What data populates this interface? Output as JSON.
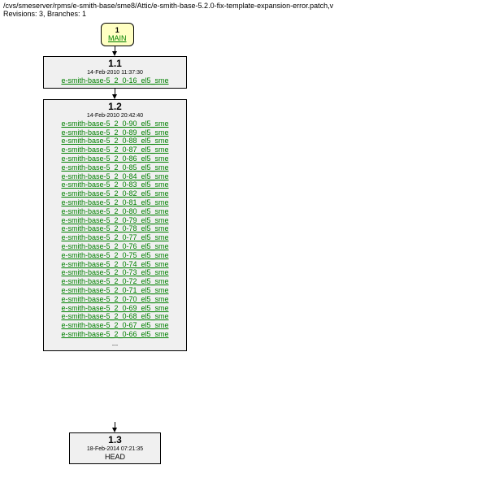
{
  "header": {
    "path": "/cvs/smeserver/rpms/e-smith-base/sme8/Attic/e-smith-base-5.2.0-fix-template-expansion-error.patch,v",
    "stats": "Revisions: 3, Branches: 1"
  },
  "branch": {
    "num": "1",
    "name": "MAIN"
  },
  "rev1": {
    "num": "1.1",
    "date": "14-Feb-2010 11:37:30",
    "tag": "e-smith-base-5_2_0-16_el5_sme"
  },
  "rev2": {
    "num": "1.2",
    "date": "14-Feb-2010 20:42:40",
    "tags": [
      "e-smith-base-5_2_0-90_el5_sme",
      "e-smith-base-5_2_0-89_el5_sme",
      "e-smith-base-5_2_0-88_el5_sme",
      "e-smith-base-5_2_0-87_el5_sme",
      "e-smith-base-5_2_0-86_el5_sme",
      "e-smith-base-5_2_0-85_el5_sme",
      "e-smith-base-5_2_0-84_el5_sme",
      "e-smith-base-5_2_0-83_el5_sme",
      "e-smith-base-5_2_0-82_el5_sme",
      "e-smith-base-5_2_0-81_el5_sme",
      "e-smith-base-5_2_0-80_el5_sme",
      "e-smith-base-5_2_0-79_el5_sme",
      "e-smith-base-5_2_0-78_el5_sme",
      "e-smith-base-5_2_0-77_el5_sme",
      "e-smith-base-5_2_0-76_el5_sme",
      "e-smith-base-5_2_0-75_el5_sme",
      "e-smith-base-5_2_0-74_el5_sme",
      "e-smith-base-5_2_0-73_el5_sme",
      "e-smith-base-5_2_0-72_el5_sme",
      "e-smith-base-5_2_0-71_el5_sme",
      "e-smith-base-5_2_0-70_el5_sme",
      "e-smith-base-5_2_0-69_el5_sme",
      "e-smith-base-5_2_0-68_el5_sme",
      "e-smith-base-5_2_0-67_el5_sme",
      "e-smith-base-5_2_0-66_el5_sme"
    ],
    "ellipsis": "..."
  },
  "rev3": {
    "num": "1.3",
    "date": "18-Feb-2014 07:21:35",
    "head": "HEAD"
  }
}
